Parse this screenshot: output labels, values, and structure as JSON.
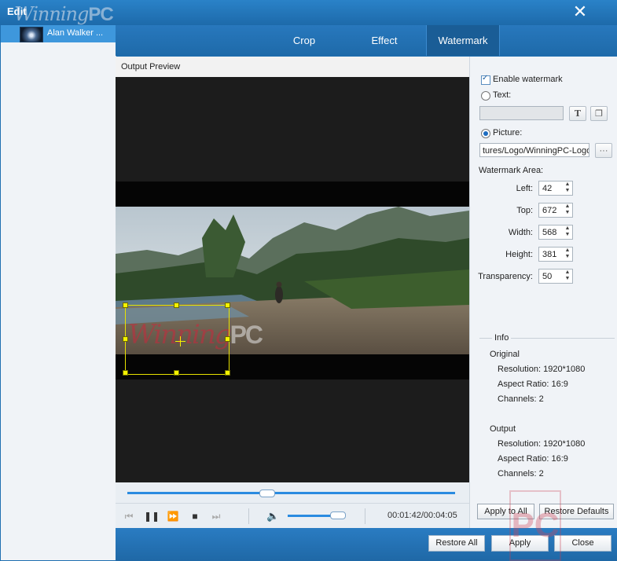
{
  "window": {
    "title": "Edit",
    "close_icon": "close-icon"
  },
  "brand": {
    "script": "Winning",
    "bold": "PC"
  },
  "sidebar": {
    "items": [
      {
        "label": "Alan Walker ..."
      }
    ]
  },
  "tabs": [
    {
      "label": "Crop"
    },
    {
      "label": "Effect"
    },
    {
      "label": "Watermark",
      "active": true
    }
  ],
  "preview": {
    "label": "Output Preview",
    "watermark_overlay": {
      "script": "Winning",
      "bold": "PC"
    }
  },
  "player": {
    "seek_progress": 0.42,
    "volume": 0.9,
    "time": "00:01:42/00:04:05"
  },
  "watermark": {
    "enable_label": "Enable watermark",
    "enabled": true,
    "text_label": "Text:",
    "text_value": "",
    "text_font_button": "T",
    "picture_label": "Picture:",
    "picture_selected": true,
    "picture_path": "tures/Logo/WinningPC-Logo",
    "browse_label": "···",
    "area_label": "Watermark Area:",
    "fields": [
      {
        "label": "Left:",
        "value": "42"
      },
      {
        "label": "Top:",
        "value": "672"
      },
      {
        "label": "Width:",
        "value": "568"
      },
      {
        "label": "Height:",
        "value": "381"
      },
      {
        "label": "Transparency:",
        "value": "50"
      }
    ]
  },
  "info": {
    "title": "Info",
    "original": {
      "heading": "Original",
      "resolution": "Resolution: 1920*1080",
      "aspect": "Aspect Ratio: 16:9",
      "channels": "Channels: 2"
    },
    "output": {
      "heading": "Output",
      "resolution": "Resolution: 1920*1080",
      "aspect": "Aspect Ratio: 16:9",
      "channels": "Channels: 2"
    }
  },
  "panel_buttons": {
    "apply_all": "Apply to All",
    "restore_defaults": "Restore Defaults"
  },
  "footer": {
    "restore_all": "Restore All",
    "apply": "Apply",
    "close": "Close"
  },
  "watermark_corner": {
    "text": "PC"
  },
  "colors": {
    "titlebar": "#1d6aaa",
    "accent": "#2a8be0",
    "selection": "#f4f200"
  }
}
